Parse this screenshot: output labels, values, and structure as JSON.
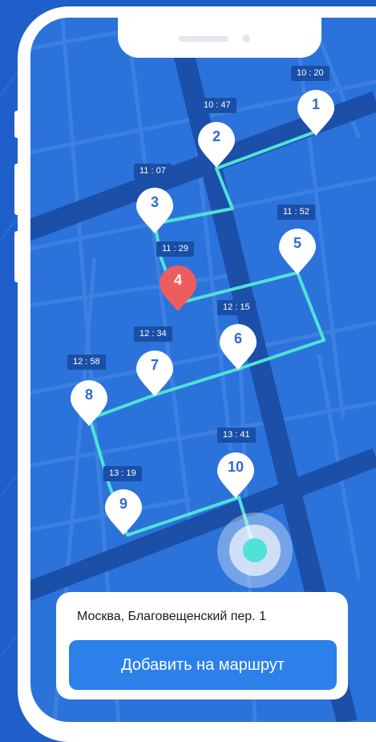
{
  "colors": {
    "background": "#1f5fc9",
    "map": "#2b72db",
    "route": "#4fe2d6",
    "pin": "#ffffff",
    "pin_active": "#ee5d5d",
    "time_badge": "#1a4fa8",
    "button": "#2b80ea"
  },
  "stops": [
    {
      "number": "1",
      "time": "10 : 20"
    },
    {
      "number": "2",
      "time": "10 : 47"
    },
    {
      "number": "3",
      "time": "11 : 07"
    },
    {
      "number": "4",
      "time": "11 : 29",
      "active": true
    },
    {
      "number": "5",
      "time": "11 : 52"
    },
    {
      "number": "6",
      "time": "12 : 15"
    },
    {
      "number": "7",
      "time": "12 : 34"
    },
    {
      "number": "8",
      "time": "12 : 58"
    },
    {
      "number": "9",
      "time": "13 : 19"
    },
    {
      "number": "10",
      "time": "13 : 41"
    }
  ],
  "location_card": {
    "address": "Москва, Благовещенский пер. 1",
    "button_label": "Добавить на маршрут"
  }
}
